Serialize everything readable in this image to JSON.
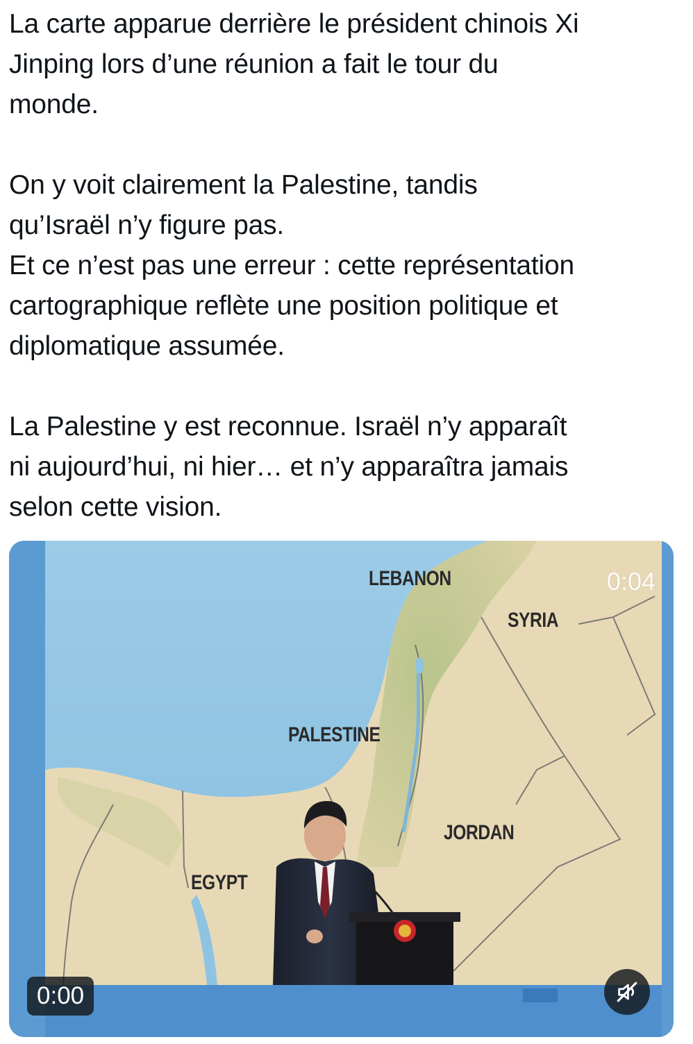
{
  "tweet": {
    "paragraphs": [
      [
        "La carte apparue derrière le président chinois Xi",
        "Jinping lors d’une réunion a fait le tour du",
        "monde."
      ],
      [
        "On y voit clairement la Palestine, tandis",
        "qu’Israël n’y figure pas.",
        "Et ce n’est pas une erreur : cette représentation",
        "cartographique reflète une position politique et",
        "diplomatique assumée."
      ],
      [
        "La Palestine y est reconnue. Israël n’y apparaît",
        "ni aujourd’hui, ni hier… et n’y apparaîtra jamais",
        "selon cette vision."
      ]
    ]
  },
  "video": {
    "duration": "0:04",
    "current_time": "0:00",
    "mute_icon": "speaker-muted-icon",
    "map_labels": {
      "lebanon": "LEBANON",
      "syria": "SYRIA",
      "palestine": "PALESTINE",
      "jordan": "JORDAN",
      "egypt": "EGYPT"
    }
  },
  "colors": {
    "text": "#0f1419",
    "sea": "#8fc3e2",
    "land": "#e6d7b4",
    "green_land": "#b9c78f",
    "overlay_badge": "#14181c"
  }
}
